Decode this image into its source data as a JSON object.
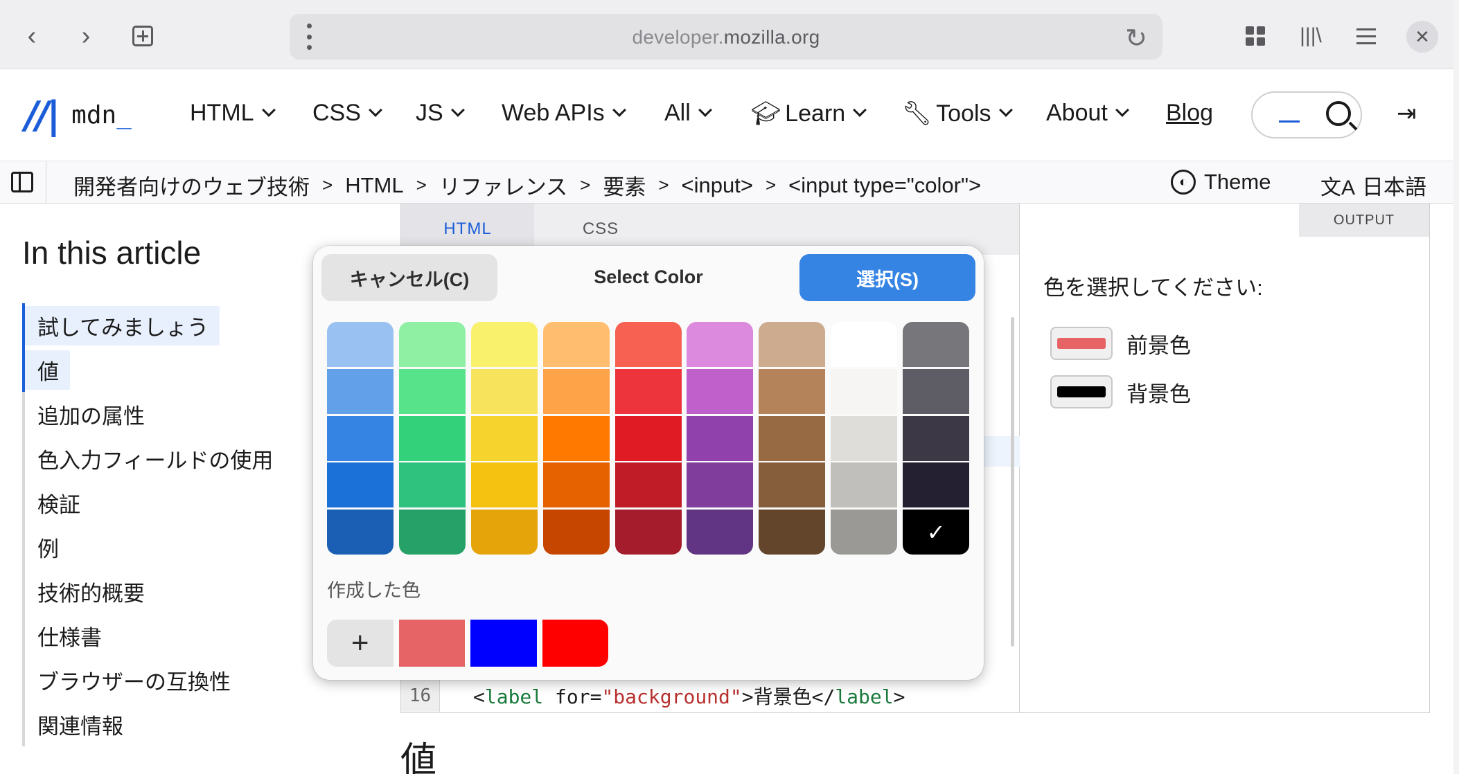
{
  "browser": {
    "url_domain_prefix": "developer.",
    "url_domain_main": "mozilla.org"
  },
  "header": {
    "logo_text": "mdn",
    "logo_cursor": "_",
    "menu": [
      {
        "label": "HTML"
      },
      {
        "label": "CSS"
      },
      {
        "label": "JS"
      },
      {
        "label": "Web APIs"
      },
      {
        "label": "All"
      },
      {
        "label": "Learn"
      },
      {
        "label": "Tools"
      },
      {
        "label": "About"
      }
    ],
    "blog": "Blog"
  },
  "breadcrumbs": [
    "開発者向けのウェブ技術",
    "HTML",
    "リファレンス",
    "要素",
    "<input>",
    "<input type=\"color\">"
  ],
  "theme_label": "Theme",
  "language_label": "日本語",
  "toc": {
    "title": "In this article",
    "items": [
      "試してみましょう",
      "値",
      "追加の属性",
      "色入力フィールドの使用",
      "検証",
      "例",
      "技術的概要",
      "仕様書",
      "ブラウザーの互換性",
      "関連情報"
    ]
  },
  "editor": {
    "tabs": [
      "HTML",
      "CSS"
    ],
    "line_number": "16",
    "code": {
      "open_tag_start": "<",
      "tag": "label",
      "attr": " for=",
      "attr_value": "\"background\"",
      "content": ">背景色</",
      "close_tag": "label",
      "end": ">"
    }
  },
  "output": {
    "tab": "OUTPUT",
    "prompt": "色を選択してください:",
    "fields": [
      {
        "label": "前景色",
        "color": "#e66465"
      },
      {
        "label": "背景色",
        "color": "#000000"
      }
    ]
  },
  "section_heading": "値",
  "picker": {
    "title": "Select Color",
    "cancel": "キャンセル(C)",
    "select": "選択(S)",
    "custom_label": "作成した色",
    "add_icon": "+",
    "palette": [
      [
        "#99c1f1",
        "#62a0ea",
        "#3584e4",
        "#1c71d8",
        "#1a5fb4"
      ],
      [
        "#8ff0a4",
        "#57e389",
        "#33d17a",
        "#2ec27e",
        "#26a269"
      ],
      [
        "#f9f06b",
        "#f8e45c",
        "#f6d32d",
        "#f5c211",
        "#e5a50a"
      ],
      [
        "#ffbe6f",
        "#ffa348",
        "#ff7800",
        "#e66100",
        "#c64600"
      ],
      [
        "#f66151",
        "#ed333b",
        "#e01b24",
        "#c01c28",
        "#a51d2d"
      ],
      [
        "#dc8add",
        "#c061cb",
        "#9141ac",
        "#813d9c",
        "#613583"
      ],
      [
        "#cdab8f",
        "#b5835a",
        "#986a44",
        "#865e3c",
        "#63452c"
      ],
      [
        "#ffffff",
        "#f6f5f4",
        "#deddda",
        "#c0bfbc",
        "#9a9996"
      ],
      [
        "#77767b",
        "#5e5c64",
        "#3d3846",
        "#241f31",
        "#000000"
      ]
    ],
    "selected": {
      "column": 8,
      "row": 4
    },
    "custom_colors": [
      "#e66465",
      "#0000ff",
      "#ff0000"
    ]
  }
}
